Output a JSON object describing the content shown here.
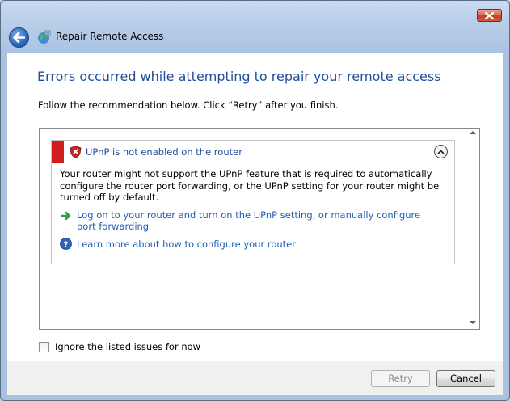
{
  "window": {
    "title": "Repair Remote Access",
    "close_icon": "close-icon",
    "back_icon": "back-arrow-icon",
    "app_icon": "network-globe-icon"
  },
  "content": {
    "heading": "Errors occurred while attempting to repair your remote access",
    "instruction": "Follow the recommendation below. Click “Retry” after you finish."
  },
  "issue": {
    "title": "UPnP is not enabled on the router",
    "status_color": "#d11f1f",
    "description": "Your router might not support the UPnP feature that is required to automatically configure the router port forwarding, or the UPnP setting for your router might be turned off by default.",
    "action_text": "Log on to your router and turn on the UPnP setting, or manually configure port forwarding",
    "learn_more": "Learn more about how to configure your router"
  },
  "options": {
    "ignore_label": "Ignore the listed issues for now",
    "ignore_checked": false
  },
  "buttons": {
    "retry": "Retry",
    "cancel": "Cancel"
  }
}
